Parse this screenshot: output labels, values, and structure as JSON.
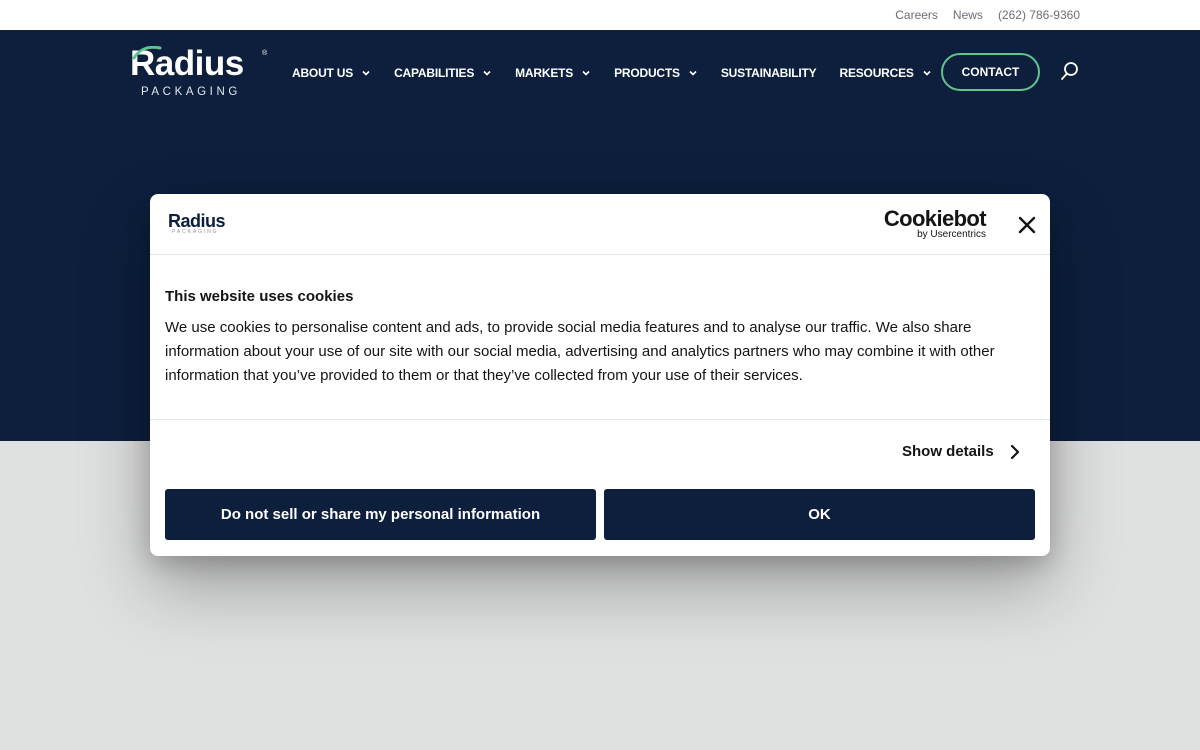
{
  "topbar": {
    "links": [
      "Careers",
      "News",
      "(262) 786-9360"
    ]
  },
  "header": {
    "logo": {
      "word": "Radius",
      "sub": "PACKAGING",
      "reg": "®"
    },
    "nav": [
      {
        "label": "ABOUT US",
        "has_menu": true
      },
      {
        "label": "CAPABILITIES",
        "has_menu": true
      },
      {
        "label": "MARKETS",
        "has_menu": true
      },
      {
        "label": "PRODUCTS",
        "has_menu": true
      },
      {
        "label": "SUSTAINABILITY",
        "has_menu": false
      },
      {
        "label": "RESOURCES",
        "has_menu": true
      }
    ],
    "contact_label": "CONTACT"
  },
  "cookie_dialog": {
    "logo": {
      "word": "Radius",
      "sub": "PACKAGING"
    },
    "brand": {
      "main": "Cookiebot",
      "sub": "by Usercentrics"
    },
    "title": "This website uses cookies",
    "body": "We use cookies to personalise content and ads, to provide social media features and to analyse our traffic. We also share information about your use of our site with our social media, advertising and analytics partners who may combine it with other information that you’ve provided to them or that they’ve collected from your use of their services.",
    "show_details_label": "Show details",
    "deny_label": "Do not sell or share my personal information",
    "ok_label": "OK"
  },
  "colors": {
    "navy": "#0d1f3d",
    "accent_green": "#5fc58e",
    "page_gray": "#dfe0e0"
  },
  "icons": {
    "close": "close-icon",
    "search": "search-icon",
    "chevron": "chevron-down-icon",
    "details": "chevron-right-icon"
  }
}
